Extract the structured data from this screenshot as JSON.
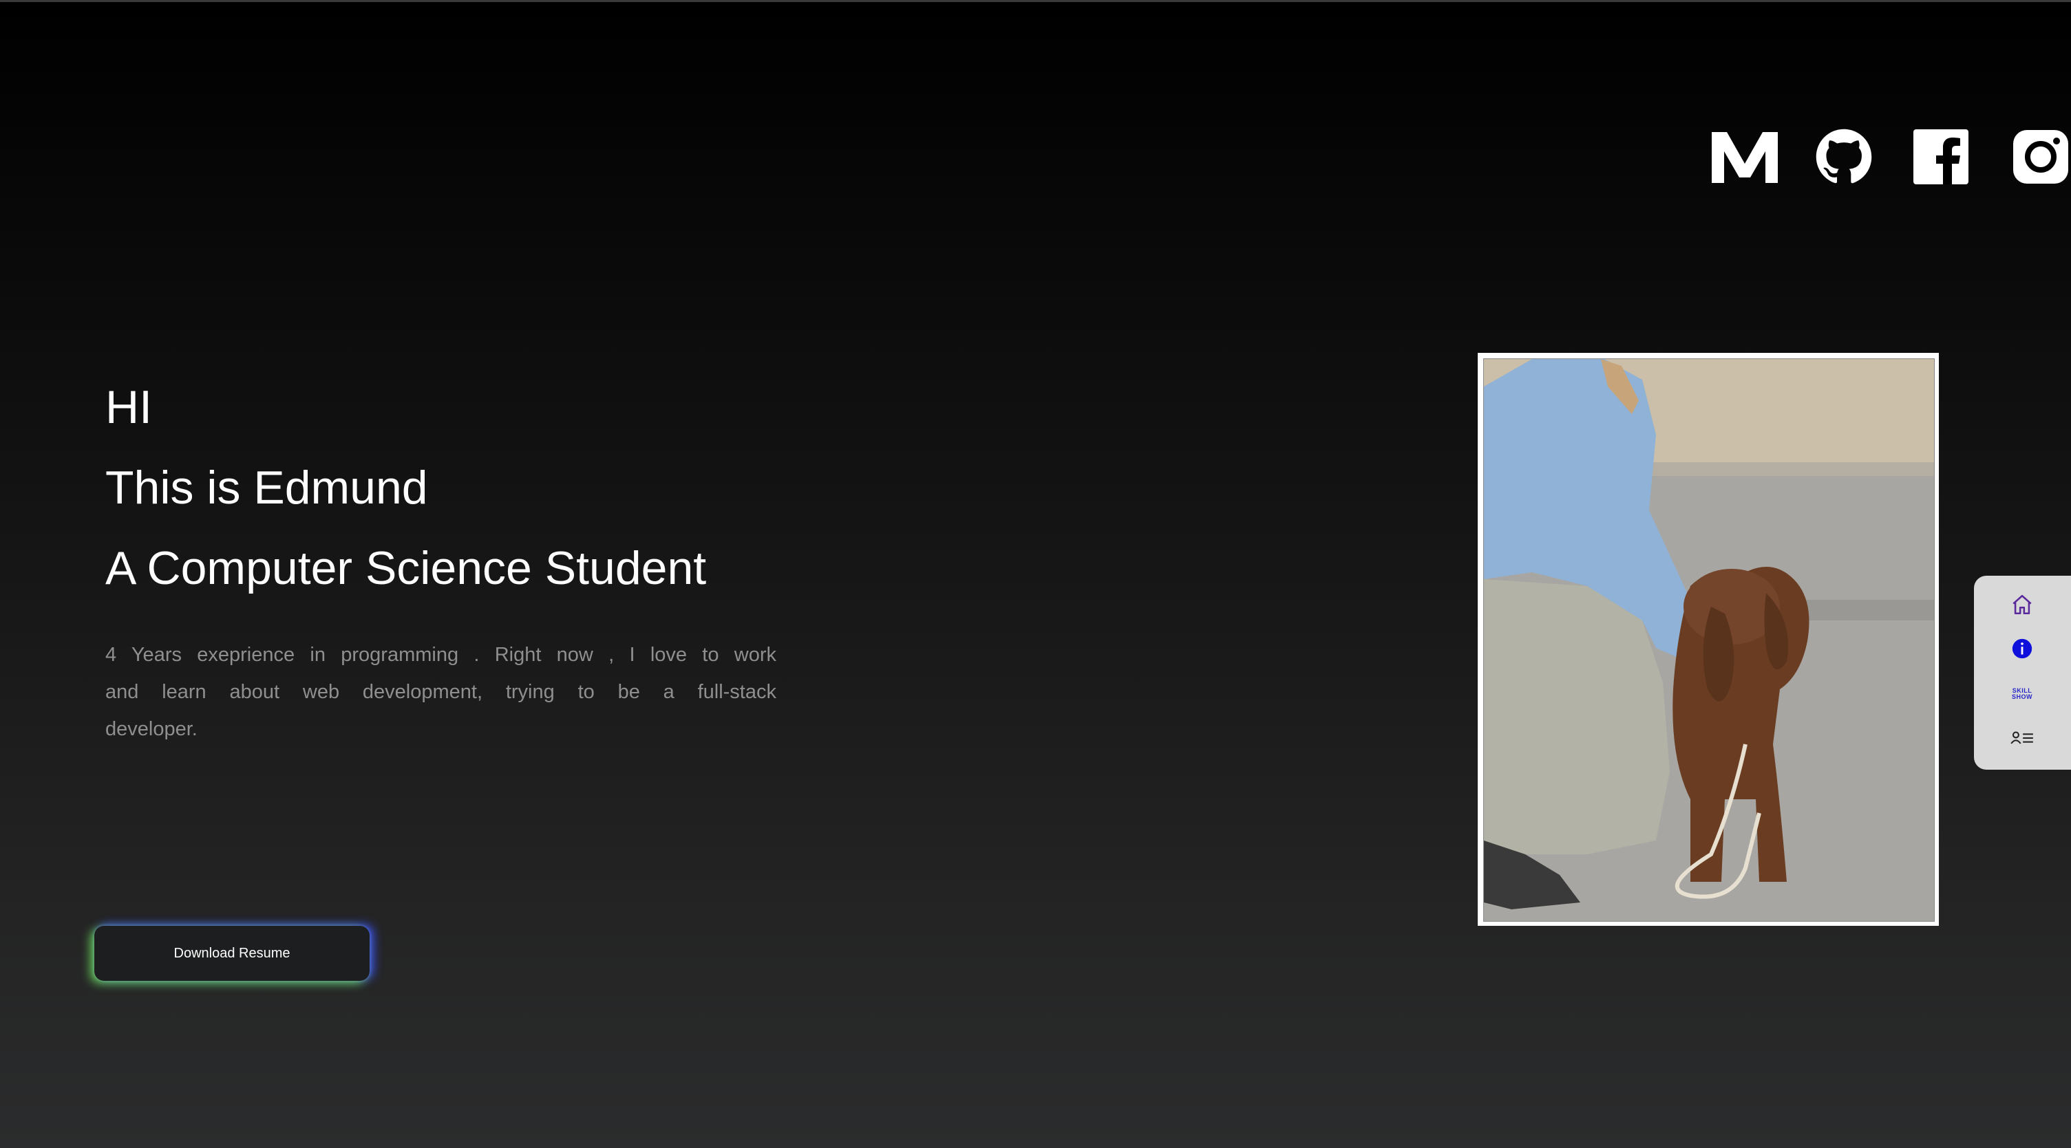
{
  "socials": [
    {
      "name": "medium",
      "icon": "medium-icon"
    },
    {
      "name": "github",
      "icon": "github-icon"
    },
    {
      "name": "facebook",
      "icon": "facebook-icon"
    },
    {
      "name": "instagram",
      "icon": "instagram-icon"
    }
  ],
  "hero": {
    "greeting": "HI",
    "intro": "This is Edmund",
    "role": "A Computer Science Student",
    "description": "4 Years exeprience in programming . Right now , I love to work and learn about  web development, trying to be a full-stack developer."
  },
  "download_button": {
    "label": "Download Resume"
  },
  "photo": {
    "alt": "Person in a blue jacket petting a brown spaniel dog"
  },
  "side_nav": {
    "items": [
      {
        "name": "home",
        "icon": "home-icon"
      },
      {
        "name": "about",
        "icon": "info-icon"
      },
      {
        "name": "skills",
        "label": "SKILL SHOW",
        "icon": "skills-icon"
      },
      {
        "name": "resume",
        "icon": "resume-list-icon"
      }
    ]
  },
  "colors": {
    "background_top": "#000000",
    "background_bottom": "#2b2c2d",
    "text_primary": "#ffffff",
    "text_secondary": "#8f8f8f",
    "nav_bg": "#d9d9d9",
    "accent_blue": "#1010dd",
    "button_glow_green": "#6edc5a",
    "button_glow_blue": "#3c50ff"
  }
}
